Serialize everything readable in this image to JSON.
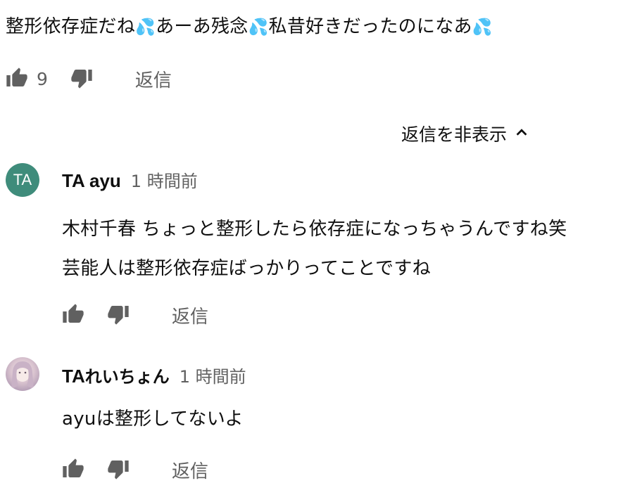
{
  "parent_comment": {
    "parts": [
      "整形依存症だね",
      "💦",
      "あーあ残念",
      "💦",
      "私昔好きだったのになあ",
      "💦"
    ],
    "like_count": "9",
    "reply_label": "返信"
  },
  "replies_toggle": {
    "label": "返信を非表示"
  },
  "replies": [
    {
      "avatar_initials": "TA",
      "avatar_color": "#3f8c7b",
      "author": "TA ayu",
      "time": "1 時間前",
      "lines": [
        "木村千春 ちょっと整形したら依存症になっちゃうんですね笑",
        "芸能人は整形依存症ばっかりってことですね"
      ],
      "reply_label": "返信"
    },
    {
      "author_latin": "TA",
      "author_jp": "れいちょん",
      "time": "1 時間前",
      "lines": [
        "ayuは整形してないよ"
      ],
      "reply_label": "返信"
    }
  ],
  "icons": [
    "thumbs-up-icon",
    "thumbs-down-icon",
    "chevron-up-icon"
  ]
}
